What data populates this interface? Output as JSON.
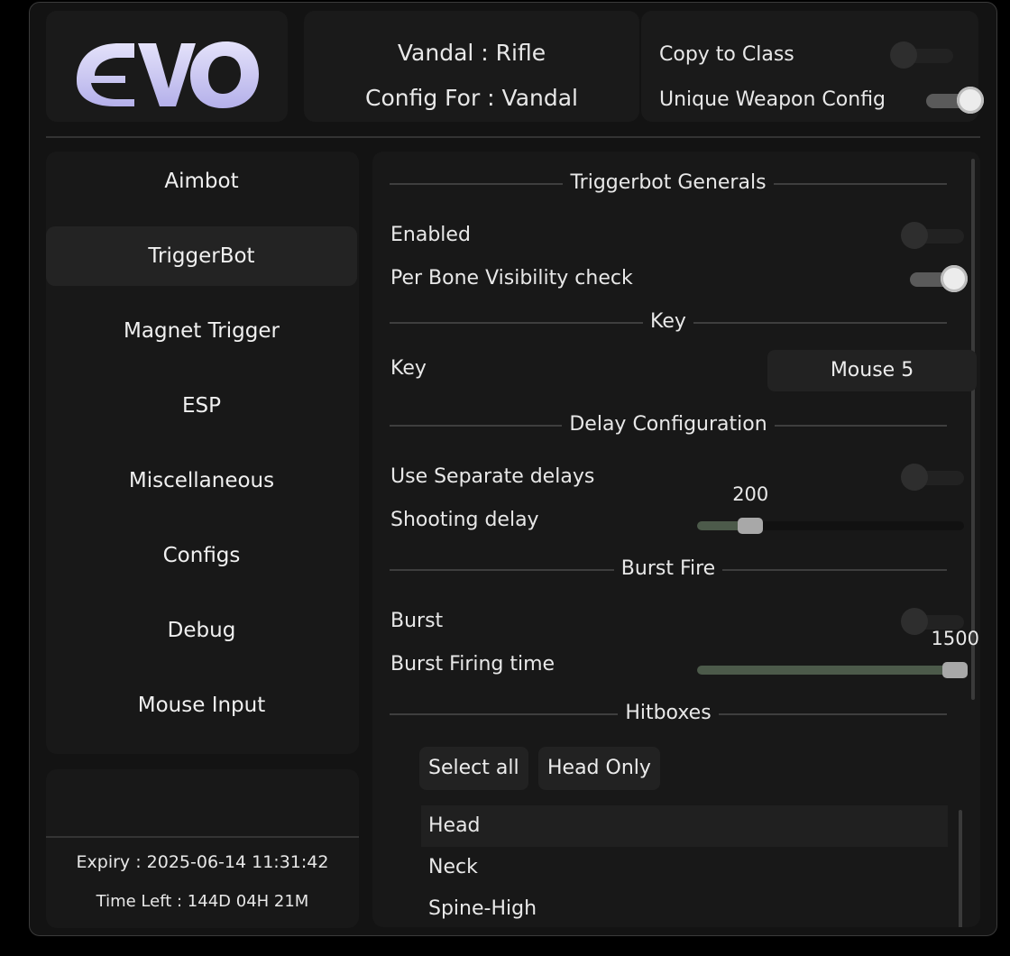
{
  "header": {
    "logo_text": "EVO",
    "weapon_line": "Vandal : Rifle",
    "config_line": "Config For : Vandal",
    "copy_to_class_label": "Copy to Class",
    "copy_to_class_on": false,
    "unique_weapon_config_label": "Unique Weapon Config",
    "unique_weapon_config_on": true
  },
  "sidebar": {
    "items": [
      {
        "label": "Aimbot",
        "active": false
      },
      {
        "label": "TriggerBot",
        "active": true
      },
      {
        "label": "Magnet Trigger",
        "active": false
      },
      {
        "label": "ESP",
        "active": false
      },
      {
        "label": "Miscellaneous",
        "active": false
      },
      {
        "label": "Configs",
        "active": false
      },
      {
        "label": "Debug",
        "active": false
      },
      {
        "label": "Mouse Input",
        "active": false
      }
    ]
  },
  "license": {
    "expiry": "Expiry : 2025-06-14 11:31:42",
    "time_left": "Time Left : 144D 04H 21M"
  },
  "triggerbot": {
    "sections": {
      "generals": "Triggerbot Generals",
      "key": "Key",
      "delay": "Delay Configuration",
      "burst": "Burst Fire",
      "hitboxes": "Hitboxes"
    },
    "enabled_label": "Enabled",
    "enabled_on": false,
    "bone_check_label": "Per Bone Visibility check",
    "bone_check_on": true,
    "key_label": "Key",
    "key_value": "Mouse 5",
    "separate_delays_label": "Use Separate delays",
    "separate_delays_on": false,
    "shooting_delay_label": "Shooting delay",
    "shooting_delay_value": "200",
    "shooting_delay_fraction": 0.2,
    "burst_label": "Burst",
    "burst_on": false,
    "burst_time_label": "Burst Firing time",
    "burst_time_value": "1500",
    "burst_time_fraction": 1.0,
    "select_all_label": "Select all",
    "head_only_label": "Head Only",
    "hitboxes": [
      {
        "label": "Head",
        "selected": true
      },
      {
        "label": "Neck",
        "selected": false
      },
      {
        "label": "Spine-High",
        "selected": false
      }
    ]
  },
  "colors": {
    "background": "#131313",
    "panel": "#181818",
    "accent_logo": "#ccc8f4",
    "slider_fill": "#4c5a4a"
  }
}
